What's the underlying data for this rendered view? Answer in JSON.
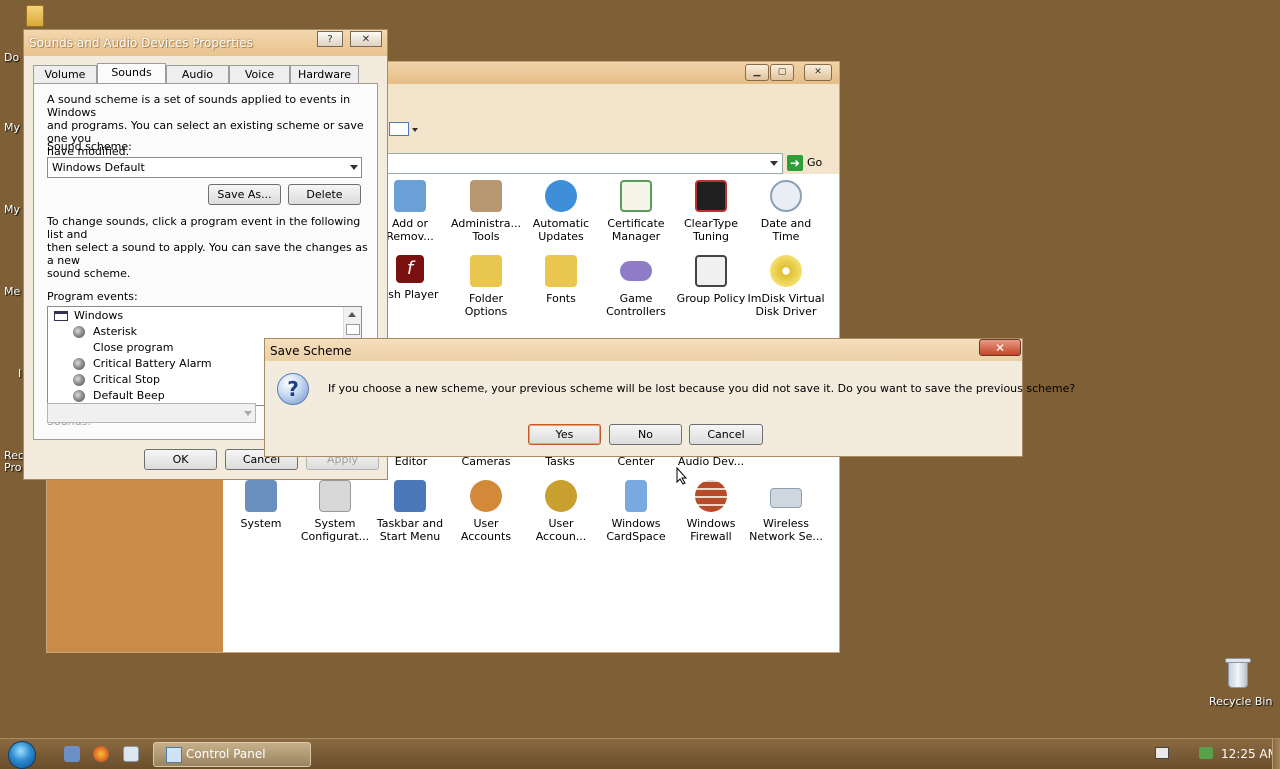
{
  "desktop": {
    "left_labels": [
      "Do",
      "My",
      "My",
      "Me",
      "I",
      "Rec",
      "Pro"
    ],
    "recycle_bin_label": "Recycle Bin"
  },
  "control_panel": {
    "address_go_label": "Go",
    "items_row1": [
      {
        "label": "Add or\nRemov...",
        "icon": "add-remove-programs-icon",
        "color": "#6aa0d6"
      },
      {
        "label": "Administra...\nTools",
        "icon": "administrative-tools-icon",
        "color": "#b89870"
      },
      {
        "label": "Automatic\nUpdates",
        "icon": "automatic-updates-icon",
        "color": "#3e8ed8"
      },
      {
        "label": "Certificate\nManager",
        "icon": "certificate-icon",
        "color": "#5a9a5a"
      },
      {
        "label": "ClearType\nTuning",
        "icon": "cleartype-icon",
        "color": "#c03030"
      },
      {
        "label": "Date and\nTime",
        "icon": "date-time-icon",
        "color": "#8aa0b8"
      }
    ],
    "items_row2": [
      {
        "label": "ash Player",
        "icon": "flash-player-icon",
        "color": "#7a1010"
      },
      {
        "label": "Folder\nOptions",
        "icon": "folder-options-icon",
        "color": "#e8c650"
      },
      {
        "label": "Fonts",
        "icon": "fonts-icon",
        "color": "#e8c650"
      },
      {
        "label": "Game\nControllers",
        "icon": "game-controller-icon",
        "color": "#8f7cc8"
      },
      {
        "label": "Group Policy",
        "icon": "group-policy-icon",
        "color": "#444444"
      },
      {
        "label": "ImDisk Virtual\nDisk Driver",
        "icon": "cd-disk-icon",
        "color": "#e0c030"
      }
    ],
    "items_row3_partial": [
      "Editor",
      "Cameras",
      "Tasks",
      "Center",
      "Audio Dev..."
    ],
    "items_row4": [
      {
        "label": "System",
        "icon": "system-icon",
        "color": "#6b90c0"
      },
      {
        "label": "System\nConfigurat...",
        "icon": "system-config-icon",
        "color": "#9a9a9a"
      },
      {
        "label": "Taskbar and\nStart Menu",
        "icon": "taskbar-icon",
        "color": "#4a78b8"
      },
      {
        "label": "User\nAccounts",
        "icon": "user-accounts-icon",
        "color": "#d28a3a"
      },
      {
        "label": "User\nAccoun...",
        "icon": "user-accounts-key-icon",
        "color": "#c8a030"
      },
      {
        "label": "Windows\nCardSpace",
        "icon": "cardspace-icon",
        "color": "#7aa8e0"
      },
      {
        "label": "Windows\nFirewall",
        "icon": "firewall-icon",
        "color": "#b84a2a"
      },
      {
        "label": "Wireless\nNetwork Se...",
        "icon": "wireless-icon",
        "color": "#8aa0b0"
      }
    ]
  },
  "sounds_dialog": {
    "title": "Sounds and Audio Devices Properties",
    "help_label": "?",
    "close_label": "✕",
    "tabs": [
      "Volume",
      "Sounds",
      "Audio",
      "Voice",
      "Hardware"
    ],
    "intro_lines": [
      "A sound scheme is a set of sounds applied to events in Windows",
      "and programs.  You can select an existing scheme or save one you",
      "have modified."
    ],
    "scheme_label": "Sound scheme:",
    "scheme_value": "Windows Default",
    "save_as_label": "Save As...",
    "delete_label": "Delete",
    "change_lines": [
      "To change sounds, click a program event in the following list and",
      "then select a sound to apply.  You can save the changes as a new",
      "sound scheme."
    ],
    "events_label": "Program events:",
    "events": [
      "Windows",
      "Asterisk",
      "Close program",
      "Critical Battery Alarm",
      "Critical Stop",
      "Default Beep"
    ],
    "sounds_label": "Sounds:",
    "ok_label": "OK",
    "cancel_label": "Cancel",
    "apply_label": "Apply"
  },
  "save_scheme_dialog": {
    "title": "Save Scheme",
    "close_label": "✕",
    "message": "If you choose a new scheme, your previous scheme will be lost because you did not save it.  Do you want to save the previous scheme?",
    "yes_label": "Yes",
    "no_label": "No",
    "cancel_label": "Cancel"
  },
  "taskbar": {
    "task_label": "Control Panel",
    "clock": "12:25 AM"
  }
}
